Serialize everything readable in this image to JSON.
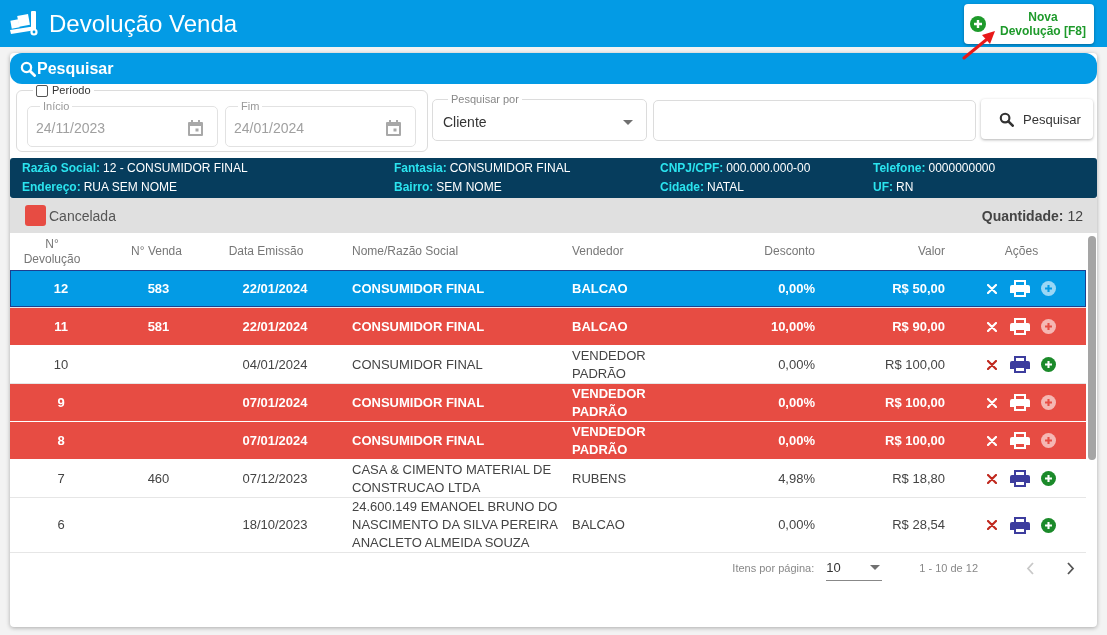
{
  "header": {
    "title": "Devolução Venda",
    "new_button": "Nova Devolução [F8]"
  },
  "search_panel": {
    "title": "Pesquisar",
    "period": {
      "label": "Período",
      "checked": false,
      "start": {
        "label": "Início",
        "value": "24/11/2023",
        "disabled": true
      },
      "end": {
        "label": "Fim",
        "value": "24/01/2024",
        "disabled": true
      }
    },
    "search_by": {
      "label": "Pesquisar por",
      "value": "Cliente"
    },
    "search_button": "Pesquisar"
  },
  "client_info": [
    {
      "label": "Razão Social:",
      "value": "12 - CONSUMIDOR FINAL"
    },
    {
      "label": "Fantasia:",
      "value": "CONSUMIDOR FINAL"
    },
    {
      "label": "CNPJ/CPF:",
      "value": "000.000.000-00"
    },
    {
      "label": "Telefone:",
      "value": "0000000000"
    },
    {
      "label": "Endereço:",
      "value": "RUA SEM NOME"
    },
    {
      "label": "Bairro:",
      "value": "SEM NOME"
    },
    {
      "label": "Cidade:",
      "value": "NATAL"
    },
    {
      "label": "UF:",
      "value": "RN"
    }
  ],
  "legend": [
    {
      "label": "Cancelada",
      "color": "#e74c43"
    }
  ],
  "count": {
    "label": "Quantidade:",
    "value": "12"
  },
  "table": {
    "columns": [
      "N° Devolução",
      "N° Venda",
      "Data Emissão",
      "Nome/Razão Social",
      "Vendedor",
      "Desconto",
      "Valor",
      "Ações"
    ],
    "rows": [
      {
        "n_devolucao": "12",
        "n_venda": "583",
        "data_emissao": "22/01/2024",
        "nome": "CONSUMIDOR FINAL",
        "vendedor": "BALCAO",
        "desconto": "0,00%",
        "valor": "R$ 50,00",
        "selected": true,
        "cancelled": false
      },
      {
        "n_devolucao": "11",
        "n_venda": "581",
        "data_emissao": "22/01/2024",
        "nome": "CONSUMIDOR FINAL",
        "vendedor": "BALCAO",
        "desconto": "10,00%",
        "valor": "R$ 90,00",
        "selected": false,
        "cancelled": true
      },
      {
        "n_devolucao": "10",
        "data_emissao": "04/01/2024",
        "nome": "CONSUMIDOR FINAL",
        "vendedor": "VENDEDOR PADRÃO",
        "desconto": "0,00%",
        "valor": "R$ 100,00",
        "selected": false,
        "cancelled": false
      },
      {
        "n_devolucao": "9",
        "data_emissao": "07/01/2024",
        "nome": "CONSUMIDOR FINAL",
        "vendedor": "VENDEDOR PADRÃO",
        "desconto": "0,00%",
        "valor": "R$ 100,00",
        "selected": false,
        "cancelled": true
      },
      {
        "n_devolucao": "8",
        "data_emissao": "07/01/2024",
        "nome": "CONSUMIDOR FINAL",
        "vendedor": "VENDEDOR PADRÃO",
        "desconto": "0,00%",
        "valor": "R$ 100,00",
        "selected": false,
        "cancelled": true
      },
      {
        "n_devolucao": "7",
        "n_venda": "460",
        "data_emissao": "07/12/2023",
        "nome": "CASA & CIMENTO MATERIAL DE CONSTRUCAO LTDA",
        "vendedor": "RUBENS",
        "desconto": "4,98%",
        "valor": "R$ 18,80",
        "selected": false,
        "cancelled": false
      },
      {
        "n_devolucao": "6",
        "data_emissao": "18/10/2023",
        "nome": "24.600.149 EMANOEL BRUNO DO NASCIMENTO DA SILVA PEREIRA ANACLETO ALMEIDA SOUZA",
        "vendedor": "BALCAO",
        "desconto": "0,00%",
        "valor": "R$ 28,54",
        "selected": false,
        "cancelled": false
      }
    ]
  },
  "pagination": {
    "label": "Itens por página:",
    "page_size": "10",
    "range": "1 - 10 de 12",
    "previous_button": {
      "disabled": true
    },
    "next_button": {
      "disabled": false
    }
  }
}
